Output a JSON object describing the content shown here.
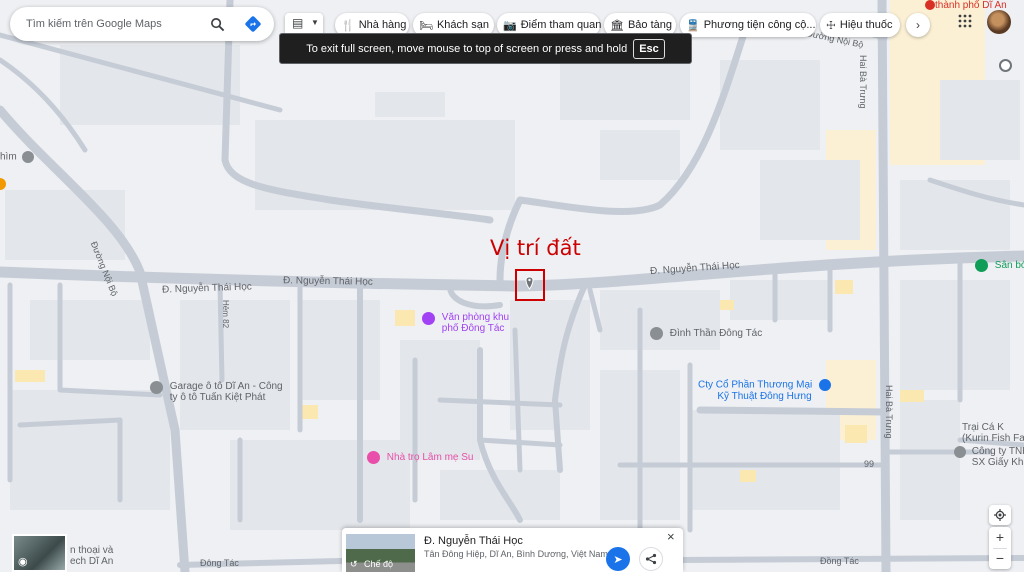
{
  "search": {
    "placeholder": "Tìm kiếm trên Google Maps"
  },
  "category_chips": [
    {
      "label": "Nhà hàng",
      "icon": "restaurant-icon"
    },
    {
      "label": "Khách sạn",
      "icon": "hotel-icon"
    },
    {
      "label": "Điểm tham quan",
      "icon": "camera-icon"
    },
    {
      "label": "Bảo tàng",
      "icon": "museum-icon"
    },
    {
      "label": "Phương tiện công cộ...",
      "icon": "transit-icon"
    },
    {
      "label": "Hiệu thuốc",
      "icon": "pharmacy-icon"
    }
  ],
  "fullscreen_toast": {
    "message": "To exit full screen, move mouse to top of screen or press and hold",
    "key": "Esc"
  },
  "annotation": {
    "label": "Vị trí đất",
    "color": "#cc0000"
  },
  "street_labels": {
    "nguyen_thai_hoc_1": "Đ. Nguyễn Thái Học",
    "nguyen_thai_hoc_2": "Đ. Nguyễn Thái Học",
    "nguyen_thai_hoc_3": "Đ. Nguyễn Thái Học",
    "noi_bo_top": "Đường Nội Bộ",
    "noi_bo_left": "Đường Nội Bộ",
    "hai_ba_trung_top": "Hai Bà Trưng",
    "hai_ba_trung_right": "Hai Bà Trưng",
    "hem_82": "Hẻm 82",
    "dong_tac_left": "Đông Tác",
    "dong_tac_right": "Đồng Tác",
    "road_99": "99"
  },
  "places": {
    "van_phong": {
      "line1": "Văn phòng khu",
      "line2": "phố Đông Tác"
    },
    "dinh_than": "Đình Thần Đông Tác",
    "cty": {
      "line1": "Cty Cổ Phần Thương Mại",
      "line2": "Kỹ Thuật Đông Hưng"
    },
    "garage": {
      "line1": "Garage ô tô Dĩ An - Công",
      "line2": "ty ô tô Tuấn Kiệt Phát"
    },
    "nha_tro": "Nhà trọ Lâm mẹ Su",
    "tp_di_an": "thành phố Dĩ An",
    "san_bo": "Sân bó",
    "trai_ca": {
      "line1": "Trại Cá K",
      "line2": "(Kurin Fish Fa"
    },
    "cong_ty_tnhh": {
      "line1": "Công ty TNH",
      "line2": "SX Giấy Khả"
    },
    "him": "hìm",
    "dien_thoai": {
      "line1": "n thoại và",
      "line2": "ech Dĩ An"
    }
  },
  "place_card": {
    "title": "Đ. Nguyễn Thái Học",
    "subtitle": "Tân Đông Hiệp, Dĩ An, Bình Dương, Việt Nam",
    "mode_label": "Chế độ"
  },
  "colors": {
    "road": "#c6ccd6",
    "water_park_accent": "#1a73e8",
    "place_purple": "#a142f4",
    "place_pink": "#e94faa",
    "place_green": "#0f9d58",
    "place_blue": "#1a73e8"
  }
}
